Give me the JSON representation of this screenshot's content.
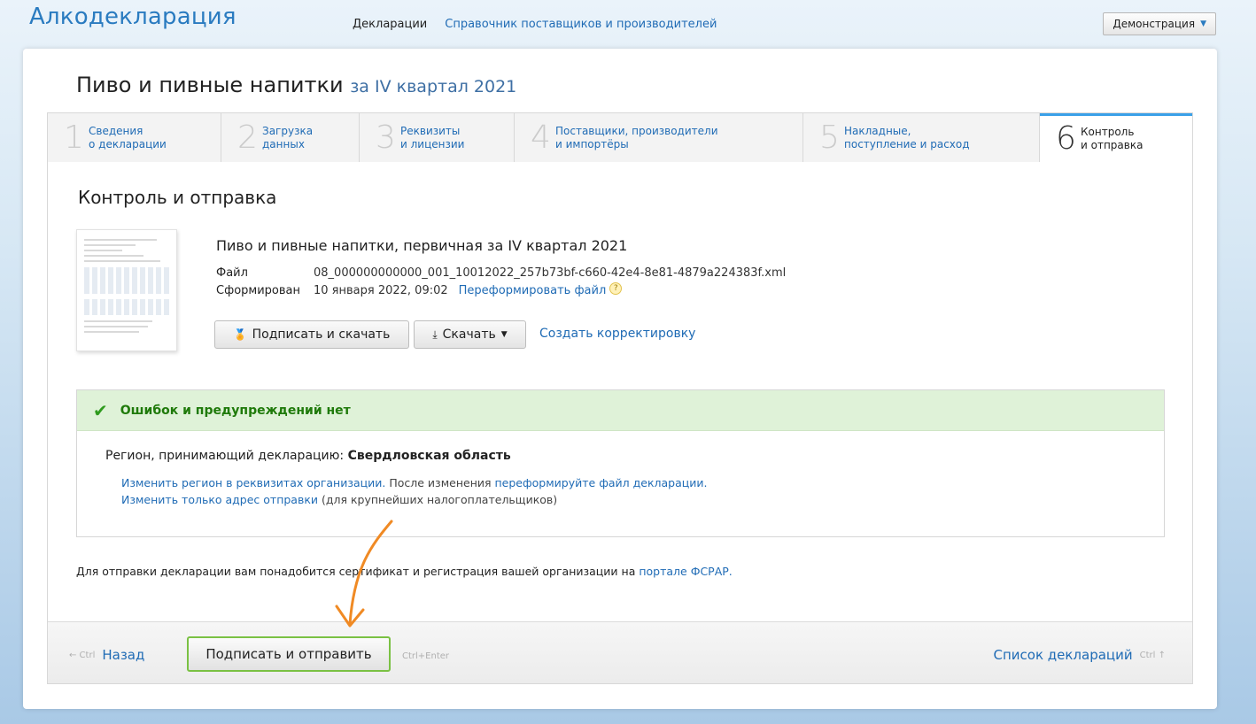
{
  "app": {
    "brand": "Алкодекларация",
    "nav": [
      "Декларации",
      "Справочник поставщиков и производителей"
    ],
    "account_button": "Демонстрация"
  },
  "declaration": {
    "title": "Пиво и пивные напитки",
    "period": "за IV квартал 2021"
  },
  "steps": [
    {
      "num": "1",
      "label": "Сведения\nо декларации"
    },
    {
      "num": "2",
      "label": "Загрузка\nданных"
    },
    {
      "num": "3",
      "label": "Реквизиты\nи лицензии"
    },
    {
      "num": "4",
      "label": "Поставщики, производители\nи импортёры"
    },
    {
      "num": "5",
      "label": "Накладные,\nпоступление и расход"
    },
    {
      "num": "6",
      "label": "Контроль\nи отправка"
    }
  ],
  "section": {
    "title": "Контроль и отправка",
    "doc_name": "Пиво и пивные напитки, первичная за IV квартал 2021",
    "file_label": "Файл",
    "file_value": "08_000000000000_001_10012022_257b73bf-c660-42e4-8e81-4879a224383f.xml",
    "formed_label": "Сформирован",
    "formed_value": "10 января 2022, 09:02",
    "reform_link": "Переформировать файл",
    "help_glyph": "?",
    "sign_download": "Подписать и скачать",
    "download": "Скачать",
    "create_correction": "Создать корректировку"
  },
  "status": {
    "message": "Ошибок и предупреждений нет",
    "region_label": "Регион, принимающий декларацию:",
    "region_value": "Свердловская область",
    "link1": "Изменить регион в реквизитах организации.",
    "text1": " После изменения ",
    "link2": "переформируйте файл декларации.",
    "link3": "Изменить только адрес отправки",
    "text2": " (для крупнейших налогоплательщиков)"
  },
  "footnote": {
    "text": "Для отправки декларации вам понадобится сертификат и регистрация вашей организации на ",
    "link": "портале ФСРАР."
  },
  "footer": {
    "back_hint": "← Ctrl",
    "back": "Назад",
    "send_button": "Подписать и отправить",
    "send_hint": "Ctrl+Enter",
    "list_link": "Список деклараций",
    "list_hint": "Ctrl ↑"
  },
  "colors": {
    "accent": "#2a7bc0",
    "success": "#1f7a0a",
    "annotation_arrow": "#f08a24"
  }
}
